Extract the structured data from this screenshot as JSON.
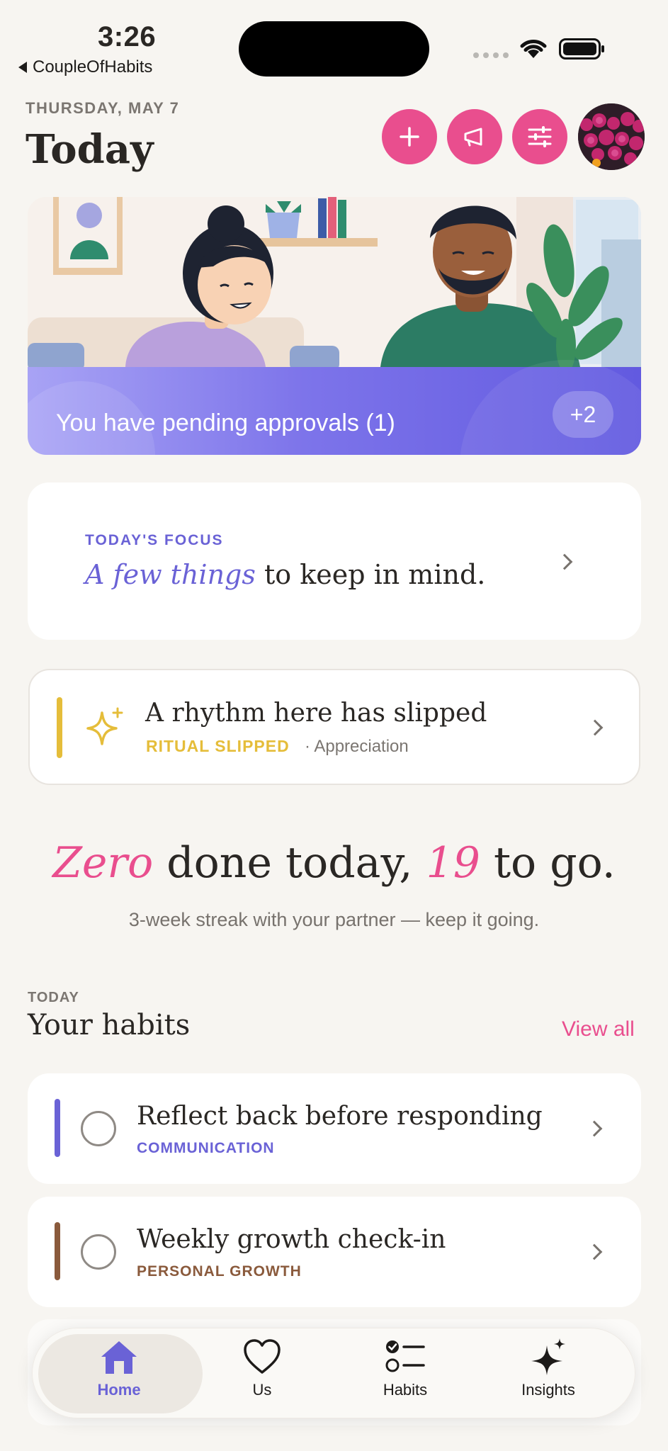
{
  "status_bar": {
    "time": "3:26",
    "back_app": "CoupleOfHabits"
  },
  "header": {
    "date": "THURSDAY, MAY 7",
    "title": "Today",
    "actions": [
      "plus-icon",
      "megaphone-icon",
      "sliders-icon"
    ],
    "accent_color": "#e94e8e"
  },
  "hero": {
    "text": "You have pending approvals (1)",
    "badge": "+2",
    "banner_color": "#7d74ea"
  },
  "focus": {
    "eyebrow": "TODAY'S FOCUS",
    "emphasis": "A few things",
    "rest": " to keep in mind."
  },
  "ritual": {
    "title": "A rhythm here has slipped",
    "tag": "RITUAL SLIPPED",
    "subtitle": "· Appreciation",
    "tag_color": "#e5bd3a"
  },
  "summary": {
    "done_word": "Zero",
    "middle": " done today, ",
    "remaining": "19",
    "end": " to go.",
    "streak": "3-week streak with your partner — keep it going."
  },
  "habits_section": {
    "eyebrow": "TODAY",
    "title": "Your habits",
    "view_all": "View all",
    "items": [
      {
        "title": "Reflect back before responding",
        "category": "COMMUNICATION",
        "color": "#6a62d6"
      },
      {
        "title": "Weekly growth check-in",
        "category": "PERSONAL GROWTH",
        "color": "#8a5a3c"
      }
    ]
  },
  "tabbar": {
    "tabs": [
      {
        "label": "Home",
        "icon": "home-icon",
        "active": true
      },
      {
        "label": "Us",
        "icon": "heart-icon",
        "active": false
      },
      {
        "label": "Habits",
        "icon": "checklist-icon",
        "active": false
      },
      {
        "label": "Insights",
        "icon": "sparkle-icon",
        "active": false
      }
    ]
  }
}
